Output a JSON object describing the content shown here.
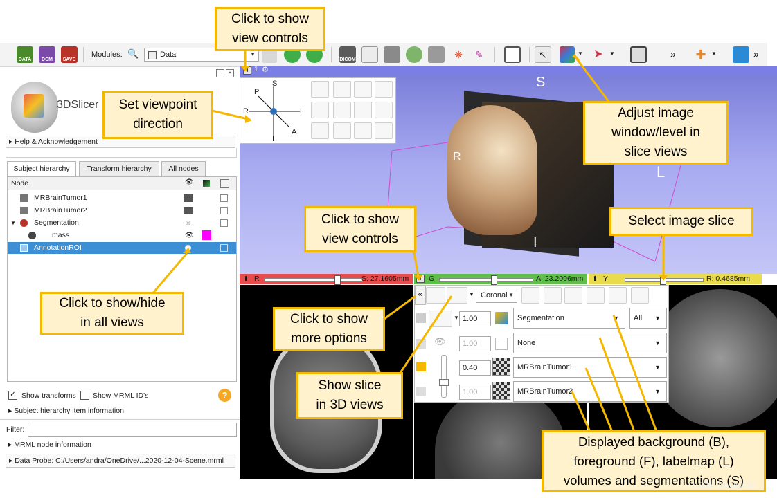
{
  "toolbar": {
    "data_label": "DATA",
    "dcm_label": "DCM",
    "save_label": "SAVE",
    "modules_label": "Modules:",
    "module_value": "Data",
    "overflow_label": "»",
    "dicom_label": "DICOM"
  },
  "panel": {
    "logo_text": "3DSlicer",
    "help_label": "Help & Acknowledgement",
    "tabs": [
      "Subject hierarchy",
      "Transform hierarchy",
      "All nodes"
    ],
    "node_header": "Node",
    "nodes": [
      "MRBrainTumor1",
      "MRBrainTumor2",
      "Segmentation",
      "mass",
      "AnnotationROI"
    ],
    "show_transforms": "Show transforms",
    "show_ids": "Show MRML ID's",
    "sh_info": "Subject hierarchy item information",
    "filter_label": "Filter:",
    "mrml_info": "MRML node information",
    "data_probe": "Data Probe: C:/Users/andra/OneDrive/...2020-12-04-Scene.mrml",
    "help_icon": "?"
  },
  "view3d": {
    "number": "1",
    "orient": {
      "s": "S",
      "r": "R",
      "l": "L",
      "i": "I"
    }
  },
  "viewpoint": {
    "p": "P",
    "s": "S",
    "r": "R",
    "l": "L",
    "a": "A",
    "i": "I"
  },
  "slices": {
    "red": {
      "letter": "R",
      "value": "S: 27.1605mm",
      "color": "#e84c4c",
      "fraction": 0.74
    },
    "green": {
      "letter": "G",
      "value": "A: 23.2096mm",
      "color": "#5fbf4a",
      "fraction": 0.58
    },
    "yellow": {
      "letter": "Y",
      "value": "R: 0.4685mm",
      "color": "#e8dc4c",
      "fraction": 0.48
    }
  },
  "slice_popup": {
    "collapse": "«",
    "orientation": "Coronal",
    "label_opacity": "1.00",
    "segmentation": "Segmentation",
    "seg_filter": "All",
    "fg_opacity": "1.00",
    "labelmap": "None",
    "bg_blend": "0.40",
    "foreground": "MRBrainTumor1",
    "bg_opacity": "1.00",
    "background": "MRBrainTumor2"
  },
  "callouts": {
    "view_controls_top": "Click to show\nview controls",
    "viewpoint": "Set viewpoint\ndirection",
    "window_level": "Adjust image\nwindow/level in\nslice views",
    "select_slice": "Select image slice",
    "view_controls_mid": "Click to show\nview controls",
    "show_hide": "Click to show/hide\nin all views",
    "more_options": "Click to show\nmore options",
    "slice_3d": "Show slice\nin 3D views",
    "displayed": "Displayed background (B),\nforeground (F), labelmap (L)\nvolumes and segmentations (S)"
  },
  "watermark": "CSDN @walt3433",
  "colors": {
    "accent": "#f5b800",
    "callout_fill": "#fff2cc",
    "selection": "#3c8fd4",
    "segment_mass": "#ff00ff"
  }
}
